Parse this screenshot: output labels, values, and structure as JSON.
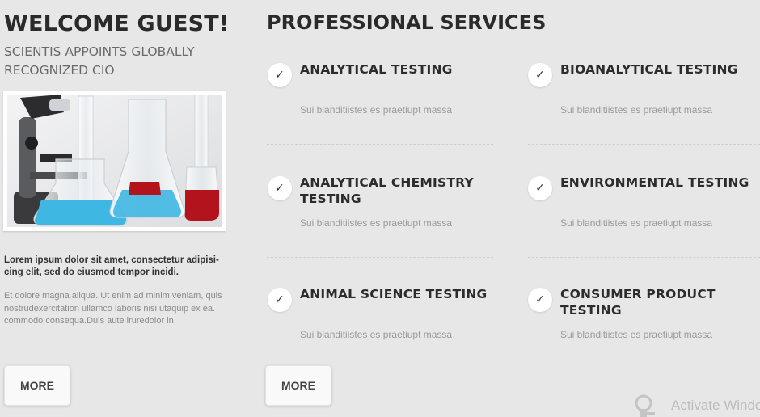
{
  "welcome": {
    "title": "WELCOME GUEST!",
    "subtitle": "SCIENTIS APPOINTS GLOBALLY RECOGNIZED CIO",
    "image_alt": "laboratory glassware and microscope",
    "intro_bold": "Lorem ipsum dolor sit amet, consectetur adipisi-cing elit, sed do eiusmod tempor incidi.",
    "intro_body": "Et dolore magna aliqua. Ut enim ad minim veniam, quis nostrudexercitation ullamco laboris nisi utaquip ex ea. commodo consequa.Duis aute iruredolor in.",
    "more_label": "MORE"
  },
  "services": {
    "title": "PROFESSIONAL SERVICES",
    "items": [
      {
        "title": "ANALYTICAL TESTING",
        "description": "Sui blanditiistes es praetiupt massa",
        "icon": "check-icon"
      },
      {
        "title": "BIOANALYTICAL TESTING",
        "description": "Sui blanditiistes es praetiupt massa",
        "icon": "check-icon"
      },
      {
        "title": "ANALYTICAL CHEMISTRY TESTING",
        "description": "Sui blanditiistes es praetiupt massa",
        "icon": "check-icon"
      },
      {
        "title": "ENVIRONMENTAL TESTING",
        "description": "Sui blanditiistes es praetiupt massa",
        "icon": "check-icon"
      },
      {
        "title": "ANIMAL SCIENCE TESTING",
        "description": "Sui blanditiistes es praetiupt massa",
        "icon": "check-icon"
      },
      {
        "title": "CONSUMER PRODUCT TESTING",
        "description": "Sui blanditiistes es praetiupt massa",
        "icon": "check-icon"
      }
    ],
    "more_label": "MORE"
  },
  "watermark": {
    "text": "Activate Windows",
    "icon": "windows-key-icon"
  },
  "colors": {
    "background": "#e7e7e7",
    "heading": "#2a2a2a",
    "muted": "#9a9a9a",
    "flask_blue": "#3fb7e3",
    "flask_red": "#b3141c"
  }
}
